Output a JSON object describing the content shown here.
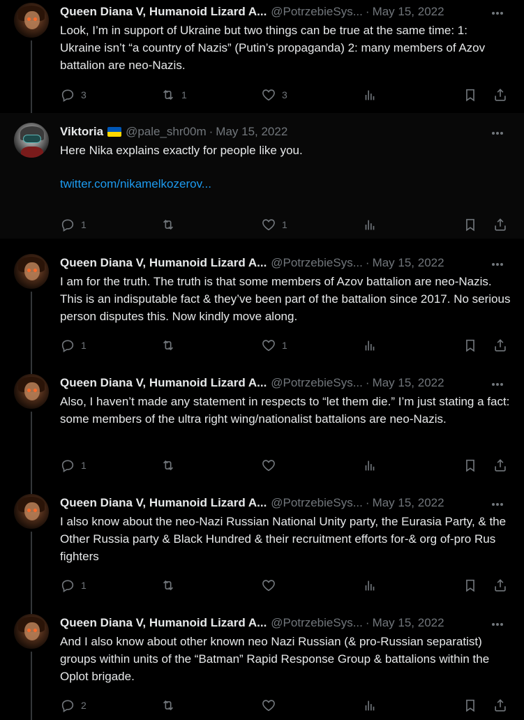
{
  "tweets": [
    {
      "name": "Queen Diana V, Humanoid Lizard A...",
      "handle": "@PotrzebieSys...",
      "date": "May 15, 2022",
      "text": "Look, I’m in support of Ukraine but two things can be true at the same time: 1: Ukraine isn’t “a country of Nazis” (Putin’s propaganda) 2: many members of Azov battalion are neo-Nazis.",
      "replies": "3",
      "retweets": "1",
      "likes": "3"
    },
    {
      "name": "Viktoria",
      "flag": "ukraine-flag",
      "handle": "@pale_shr00m",
      "date": "May 15, 2022",
      "text": "Here Nika explains exactly for people like you.",
      "link": "twitter.com/nikamelkozerov...",
      "replies": "1",
      "retweets": "",
      "likes": "1"
    },
    {
      "name": "Queen Diana V, Humanoid Lizard A...",
      "handle": "@PotrzebieSys...",
      "date": "May 15, 2022",
      "text": "I am for the truth. The truth is that some members of Azov battalion are neo-Nazis. This is an indisputable fact & they’ve been part of the battalion since 2017. No serious person disputes this. Now kindly move along.",
      "replies": "1",
      "retweets": "",
      "likes": "1"
    },
    {
      "name": "Queen Diana V, Humanoid Lizard A...",
      "handle": "@PotrzebieSys...",
      "date": "May 15, 2022",
      "text": "Also, I haven’t made any statement in respects to “let them die.” I’m just stating a fact: some members of the ultra right wing/nationalist battalions are neo-Nazis.",
      "replies": "1",
      "retweets": "",
      "likes": ""
    },
    {
      "name": "Queen Diana V, Humanoid Lizard A...",
      "handle": "@PotrzebieSys...",
      "date": "May 15, 2022",
      "text": "I also know about the neo-Nazi Russian National Unity party, the Eurasia Party, & the Other Russia party & Black Hundred & their recruitment efforts for-& org of-pro Rus fighters",
      "replies": "1",
      "retweets": "",
      "likes": ""
    },
    {
      "name": "Queen Diana V, Humanoid Lizard A...",
      "handle": "@PotrzebieSys...",
      "date": "May 15, 2022",
      "text": "And I also know about other known neo Nazi Russian (& pro-Russian separatist) groups within units of the “Batman” Rapid Response Group & battalions within the Oplot brigade.",
      "replies": "2",
      "retweets": "",
      "likes": ""
    }
  ],
  "colors": {
    "background": "#000000",
    "text": "#e7e9ea",
    "muted": "#71767b",
    "link": "#1d9bf0",
    "divider": "#333639"
  }
}
